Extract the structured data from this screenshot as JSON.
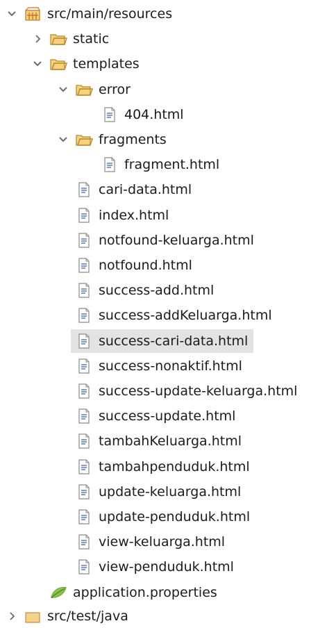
{
  "tree": {
    "top_partial_label": "",
    "bottom_partial_label": "src/test/java",
    "nodes": [
      {
        "label": "src/main/resources",
        "depth": 0,
        "expanded": true,
        "type": "package-folder",
        "icon": "package-folder-icon",
        "twisty": "expanded"
      },
      {
        "label": "static",
        "depth": 1,
        "expanded": false,
        "type": "folder",
        "icon": "folder-icon",
        "twisty": "collapsed"
      },
      {
        "label": "templates",
        "depth": 1,
        "expanded": true,
        "type": "folder",
        "icon": "folder-icon",
        "twisty": "expanded"
      },
      {
        "label": "error",
        "depth": 2,
        "expanded": true,
        "type": "folder",
        "icon": "folder-icon",
        "twisty": "expanded"
      },
      {
        "label": "404.html",
        "depth": 3,
        "type": "file",
        "icon": "html-file-icon",
        "twisty": "none"
      },
      {
        "label": "fragments",
        "depth": 2,
        "expanded": true,
        "type": "folder",
        "icon": "folder-icon",
        "twisty": "expanded"
      },
      {
        "label": "fragment.html",
        "depth": 3,
        "type": "file",
        "icon": "html-file-icon",
        "twisty": "none"
      },
      {
        "label": "cari-data.html",
        "depth": 2,
        "type": "file",
        "icon": "html-file-icon",
        "twisty": "none"
      },
      {
        "label": "index.html",
        "depth": 2,
        "type": "file",
        "icon": "html-file-icon",
        "twisty": "none"
      },
      {
        "label": "notfound-keluarga.html",
        "depth": 2,
        "type": "file",
        "icon": "html-file-icon",
        "twisty": "none"
      },
      {
        "label": "notfound.html",
        "depth": 2,
        "type": "file",
        "icon": "html-file-icon",
        "twisty": "none"
      },
      {
        "label": "success-add.html",
        "depth": 2,
        "type": "file",
        "icon": "html-file-icon",
        "twisty": "none"
      },
      {
        "label": "success-addKeluarga.html",
        "depth": 2,
        "type": "file",
        "icon": "html-file-icon",
        "twisty": "none"
      },
      {
        "label": "success-cari-data.html",
        "depth": 2,
        "type": "file",
        "icon": "html-file-icon",
        "twisty": "none",
        "selected": true
      },
      {
        "label": "success-nonaktif.html",
        "depth": 2,
        "type": "file",
        "icon": "html-file-icon",
        "twisty": "none"
      },
      {
        "label": "success-update-keluarga.html",
        "depth": 2,
        "type": "file",
        "icon": "html-file-icon",
        "twisty": "none"
      },
      {
        "label": "success-update.html",
        "depth": 2,
        "type": "file",
        "icon": "html-file-icon",
        "twisty": "none"
      },
      {
        "label": "tambahKeluarga.html",
        "depth": 2,
        "type": "file",
        "icon": "html-file-icon",
        "twisty": "none"
      },
      {
        "label": "tambahpenduduk.html",
        "depth": 2,
        "type": "file",
        "icon": "html-file-icon",
        "twisty": "none"
      },
      {
        "label": "update-keluarga.html",
        "depth": 2,
        "type": "file",
        "icon": "html-file-icon",
        "twisty": "none"
      },
      {
        "label": "update-penduduk.html",
        "depth": 2,
        "type": "file",
        "icon": "html-file-icon",
        "twisty": "none"
      },
      {
        "label": "view-keluarga.html",
        "depth": 2,
        "type": "file",
        "icon": "html-file-icon",
        "twisty": "none"
      },
      {
        "label": "view-penduduk.html",
        "depth": 2,
        "type": "file",
        "icon": "html-file-icon",
        "twisty": "none"
      },
      {
        "label": "application.properties",
        "depth": 1,
        "type": "properties",
        "icon": "properties-file-icon",
        "twisty": "none"
      }
    ]
  },
  "colors": {
    "selection": "#e3e3e3",
    "folder": "#e8b84a",
    "folder_outline": "#b5862a",
    "twisty": "#6b6b6b",
    "file_border": "#8a8a8a",
    "file_lines": "#5a7fb8",
    "leaf": "#8bc34a",
    "package": "#c9742b"
  }
}
